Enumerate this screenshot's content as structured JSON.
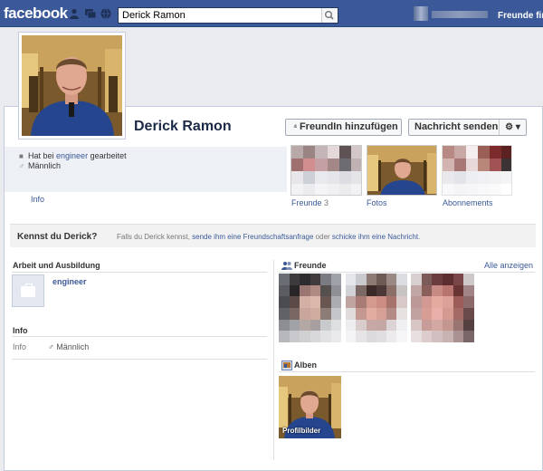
{
  "topbar": {
    "logo": "facebook",
    "search_value": "Derick Ramon",
    "friends_label": "Freunde fin"
  },
  "profile": {
    "name": "Derick Ramon",
    "add_friend_label": "FreundIn hinzufügen",
    "message_label": "Nachricht senden",
    "gear_label": "⚙ ▾"
  },
  "about": {
    "work_prefix": "Hat bei ",
    "work_place": "engineer",
    "work_suffix": " gearbeitet",
    "gender": "Männlich",
    "info_link": "Info"
  },
  "thumbs": {
    "friends_label": "Freunde",
    "friends_count": "3",
    "photos_label": "Fotos",
    "subscriptions_label": "Abonnements"
  },
  "know_bar": {
    "question": "Kennst du Derick?",
    "text1": "Falls du Derick kennst, ",
    "link1": "sende ihm eine Freundschaftsanfrage",
    "text2": " oder ",
    "link2": "schicke ihm eine Nachricht",
    "text3": "."
  },
  "left_col": {
    "work_heading": "Arbeit und Ausbildung",
    "employer": "engineer",
    "info_heading": "Info",
    "info_key": "Info",
    "info_value": "Männlich"
  },
  "right_col": {
    "friends_heading": "Freunde",
    "show_all": "Alle anzeigen",
    "albums_heading": "Alben",
    "album_name": "Profilbilder"
  },
  "colors": {
    "brand_blue": "#3b5998",
    "link": "#3b5998",
    "name": "#1c2a47"
  }
}
